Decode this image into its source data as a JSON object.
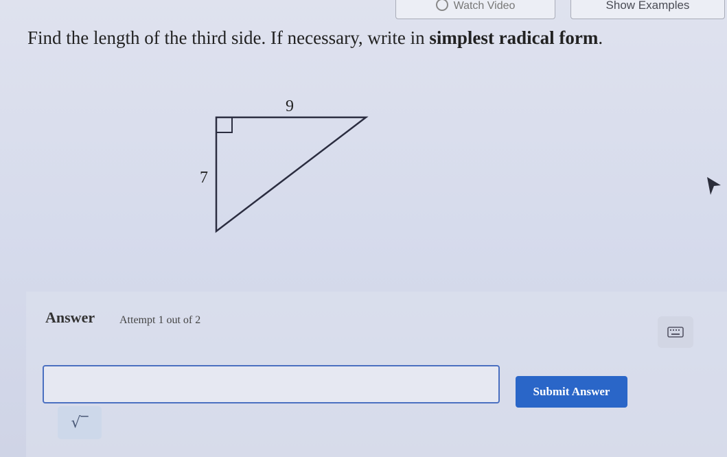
{
  "header": {
    "watch_video_label": "Watch Video",
    "show_examples_label": "Show Examples"
  },
  "question": {
    "prefix": "Find the length of the third side. If necessary, write in ",
    "emphasis": "simplest radical form",
    "suffix": "."
  },
  "figure": {
    "top_side_label": "9",
    "left_side_label": "7",
    "right_angle_marker": true
  },
  "answer": {
    "heading": "Answer",
    "attempt_text": "Attempt 1 out of 2",
    "input_value": "",
    "submit_label": "Submit Answer",
    "sqrt_symbol": "√‾",
    "keyboard_icon": "keyboard-icon"
  },
  "colors": {
    "submit_button": "#2a66c8",
    "input_border": "#4a6fc0",
    "sqrt_button_bg": "#cdd8ea"
  }
}
